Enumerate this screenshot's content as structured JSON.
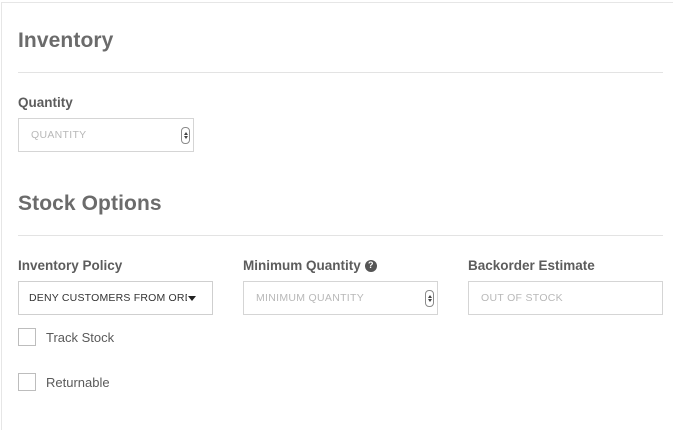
{
  "inventory": {
    "title": "Inventory",
    "quantity_label": "Quantity",
    "quantity_placeholder": "QUANTITY",
    "quantity_value": ""
  },
  "stock_options": {
    "title": "Stock Options",
    "inventory_policy_label": "Inventory Policy",
    "inventory_policy_value": "DENY CUSTOMERS FROM ORDERING",
    "minimum_quantity_label": "Minimum Quantity",
    "minimum_quantity_placeholder": "MINIMUM QUANTITY",
    "minimum_quantity_help_icon": "question-circle-icon",
    "backorder_label": "Backorder Estimate",
    "backorder_placeholder": "OUT OF STOCK",
    "track_stock_label": "Track Stock",
    "track_stock_checked": false,
    "returnable_label": "Returnable",
    "returnable_checked": false
  }
}
